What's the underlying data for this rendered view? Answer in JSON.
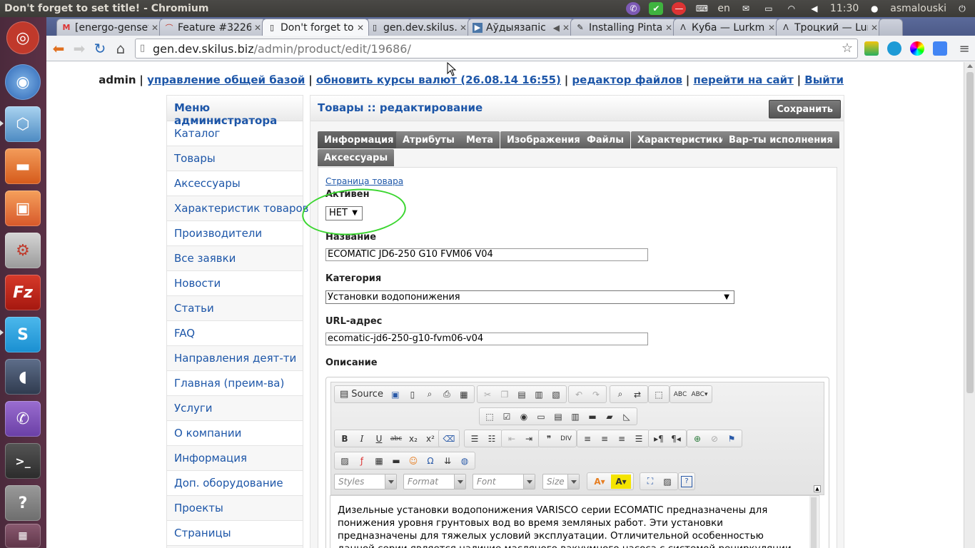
{
  "window_title": "Don't forget to set title! - Chromium",
  "system_tray": {
    "keyboard_layout": "en",
    "clock": "11:30",
    "username": "asmalouski"
  },
  "tabs": [
    {
      "title": "[energo-genset",
      "favicon": "gmail-icon"
    },
    {
      "title": "Feature #3226",
      "favicon": "redmine-icon"
    },
    {
      "title": "Don't forget to",
      "favicon": "page-icon",
      "active": true
    },
    {
      "title": "gen.dev.skilus.b",
      "favicon": "page-icon"
    },
    {
      "title": "Аўдыязапіс",
      "favicon": "audio-icon"
    },
    {
      "title": "Installing Pinta",
      "favicon": "brush-icon"
    },
    {
      "title": "Куба — Lurkmo",
      "favicon": "lambda-icon"
    },
    {
      "title": "Троцкий — Lur",
      "favicon": "lambda-icon"
    }
  ],
  "address": {
    "host": "gen.dev.skilus.biz",
    "path": "/admin/product/edit/19686/"
  },
  "topnav": {
    "user": "admin",
    "links": [
      "управление общей базой",
      "обновить курсы валют (26.08.14 16:55)",
      "редактор файлов",
      "перейти на сайт",
      "Выйти"
    ]
  },
  "menu": {
    "title": "Меню администратора",
    "items": [
      "Каталог",
      "Товары",
      "Аксессуары",
      "Характеристик товаров",
      "Производители",
      "Все заявки",
      "Новости",
      "Статьи",
      "FAQ",
      "Направления деят-ти",
      "Главная (преим-ва)",
      "Услуги",
      "О компании",
      "Информация",
      "Доп. оборудование",
      "Проекты",
      "Страницы"
    ]
  },
  "content": {
    "title": "Товары :: редактирование",
    "save_label": "Сохранить",
    "tabs": [
      "Информация",
      "Атрибуты",
      "Мета",
      "Изображения",
      "Файлы",
      "Характеристики",
      "Вар-ты исполнения",
      "Аксессуары"
    ]
  },
  "form": {
    "page_link": "Страница товара",
    "active_label": "Активен",
    "active_value": "НЕТ",
    "name_label": "Название",
    "name_value": "ECOMATIC JD6-250 G10 FVM06 V04",
    "category_label": "Категория",
    "category_value": "Установки водопонижения",
    "url_label": "URL-адрес",
    "url_value": "ecomatic-jd6-250-g10-fvm06-v04",
    "description_label": "Описание"
  },
  "editor": {
    "source_label": "Source",
    "combos": [
      "Styles",
      "Format",
      "Font",
      "Size"
    ],
    "text": "Дизельные установки водопонижения VARISCO серии ECOMATIC предназначены для понижения уровня грунтовых вод во время земляных работ. Эти установки предназначены для тяжелых условий эксплуатации. Отличительной особенностью данной серии является наличие масляного вакуумного насоса с системой рециркуляции масла, что позволяет очень быстро осуществлять"
  },
  "colors": {
    "link": "#1d56a8",
    "annotation": "#3bd630",
    "button_dark": "#555555"
  }
}
